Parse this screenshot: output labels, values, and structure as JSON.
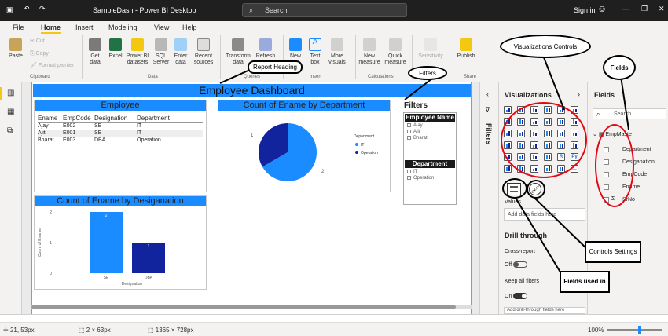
{
  "title_bar": {
    "doc_title": "SampleDash - Power BI Desktop",
    "search_placeholder": "Search",
    "sign_in": "Sign in"
  },
  "menu": [
    "File",
    "Home",
    "Insert",
    "Modeling",
    "View",
    "Help"
  ],
  "ribbon": {
    "paste": "Paste",
    "cut": "Cut",
    "copy": "Copy",
    "format_painter": "Format painter",
    "clipboard": "Clipboard",
    "get_data": "Get data",
    "excel": "Excel",
    "pbi_datasets": "Power BI datasets",
    "sql_server": "SQL Server",
    "enter_data": "Enter data",
    "recent_sources": "Recent sources",
    "data_group": "Data",
    "transform_data": "Transform data",
    "refresh": "Refresh",
    "queries_group": "Queries",
    "new_visual": "New",
    "text_box": "Text box",
    "more_visuals": "More visuals",
    "insert_group": "Insert",
    "new_measure": "New measure",
    "quick_measure": "Quick measure",
    "calculations_group": "Calculations",
    "sensitivity": "Sensitivity",
    "sensitivity_group": "Sensitivity",
    "publish": "Publish",
    "share_group": "Share"
  },
  "report": {
    "heading": "Employee Dashboard",
    "table": {
      "title": "Employee",
      "columns": [
        "Ename",
        "EmpCode",
        "Designation",
        "Department"
      ],
      "rows": [
        [
          "Ajay",
          "E002",
          "SE",
          "IT"
        ],
        [
          "Ajit",
          "E001",
          "SE",
          "IT"
        ],
        [
          "Bharat",
          "E003",
          "DBA",
          "Operation"
        ]
      ]
    },
    "bar_visual": {
      "title": "Count of Ename by Desiganation",
      "ylabel": "Count of Ename",
      "xlabel": "Designation"
    },
    "pie_visual": {
      "title": "Count of Ename by Department",
      "legend_title": "Department",
      "label_1": "1",
      "label_2": "2"
    },
    "slicer_title": "Filters",
    "slicer_employee": {
      "title": "Employee Name",
      "items": [
        "Ajay",
        "Ajit",
        "Bharat"
      ]
    },
    "slicer_department": {
      "title": "Department",
      "items": [
        "IT",
        "Operation"
      ]
    }
  },
  "chart_data": [
    {
      "type": "bar",
      "title": "Count of Ename by Desiganation",
      "categories": [
        "SE",
        "DBA"
      ],
      "values": [
        2,
        1
      ],
      "xlabel": "Designation",
      "ylabel": "Count of Ename",
      "ylim": [
        0,
        2
      ],
      "yticks": [
        "2",
        "1",
        "0"
      ],
      "colors": [
        "#1a8cff",
        "#12239e"
      ]
    },
    {
      "type": "pie",
      "title": "Count of Ename by Department",
      "labels": [
        "IT",
        "Operation"
      ],
      "values": [
        2,
        1
      ],
      "colors": [
        "#1a8cff",
        "#12239e"
      ],
      "legend": "right"
    }
  ],
  "filters_tab": "Filters",
  "viz_pane": {
    "title": "Visualizations",
    "values_label": "Values",
    "add_fields": "Add data fields here",
    "drill_through": "Drill through",
    "cross_report": "Cross-report",
    "off": "Off",
    "keep_all_filters": "Keep all filters",
    "on": "On",
    "add_drill": "Add drill-through fields here"
  },
  "fields_pane": {
    "title": "Fields",
    "search": "Search",
    "table": "EmpMaste",
    "fields": [
      "Department",
      "Desiganation",
      "EmpCode",
      "Ename",
      "SrNo"
    ]
  },
  "status": {
    "position": "21, 53px",
    "selection": "2 × 63px",
    "size": "1365 × 728px",
    "zoom": "100%"
  },
  "annotations": {
    "report_heading": "Report Heading",
    "filters": "Filters",
    "visualizations_controls": "Visualizations Controls",
    "fields": "Fields",
    "controls_settings": "Controls Settings",
    "fields_used_in": "Fields used in"
  },
  "colors": {
    "accent": "#1a8cff",
    "dark_series": "#12239e",
    "annotation": "#e30613"
  }
}
